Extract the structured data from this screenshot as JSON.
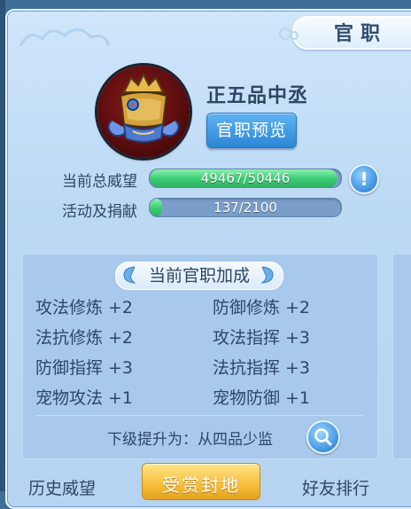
{
  "header": {
    "title": "官职"
  },
  "rank": {
    "name": "正五品中丞",
    "preview_label": "官职预览"
  },
  "stats": [
    {
      "label": "当前总威望",
      "text": "49467/50446",
      "fill": 0.98
    },
    {
      "label": "活动及捐献",
      "text": "137/2100",
      "fill": 0.065
    }
  ],
  "bonus_section": {
    "title": "当前官职加成",
    "items": [
      {
        "name": "攻法修炼",
        "value": "+2"
      },
      {
        "name": "防御修炼",
        "value": "+2"
      },
      {
        "name": "法抗修炼",
        "value": "+2"
      },
      {
        "name": "攻法指挥",
        "value": "+3"
      },
      {
        "name": "防御指挥",
        "value": "+3"
      },
      {
        "name": "法抗指挥",
        "value": "+3"
      },
      {
        "name": "宠物攻法",
        "value": "+1"
      },
      {
        "name": "宠物防御",
        "value": "+1"
      }
    ],
    "next_upgrade": "下级提升为：从四品少监"
  },
  "bottom_tabs": {
    "history": "历史威望",
    "reward": "受赏封地",
    "friends": "好友排行"
  },
  "icons": {
    "info": "info-icon",
    "search": "search-icon",
    "emblem": "official-hat-emblem"
  },
  "colors": {
    "bar_fill": "#3fcf78",
    "bar_track": "#7b9ec9",
    "button": "#2d86d6",
    "gold": "#f6be3a"
  }
}
